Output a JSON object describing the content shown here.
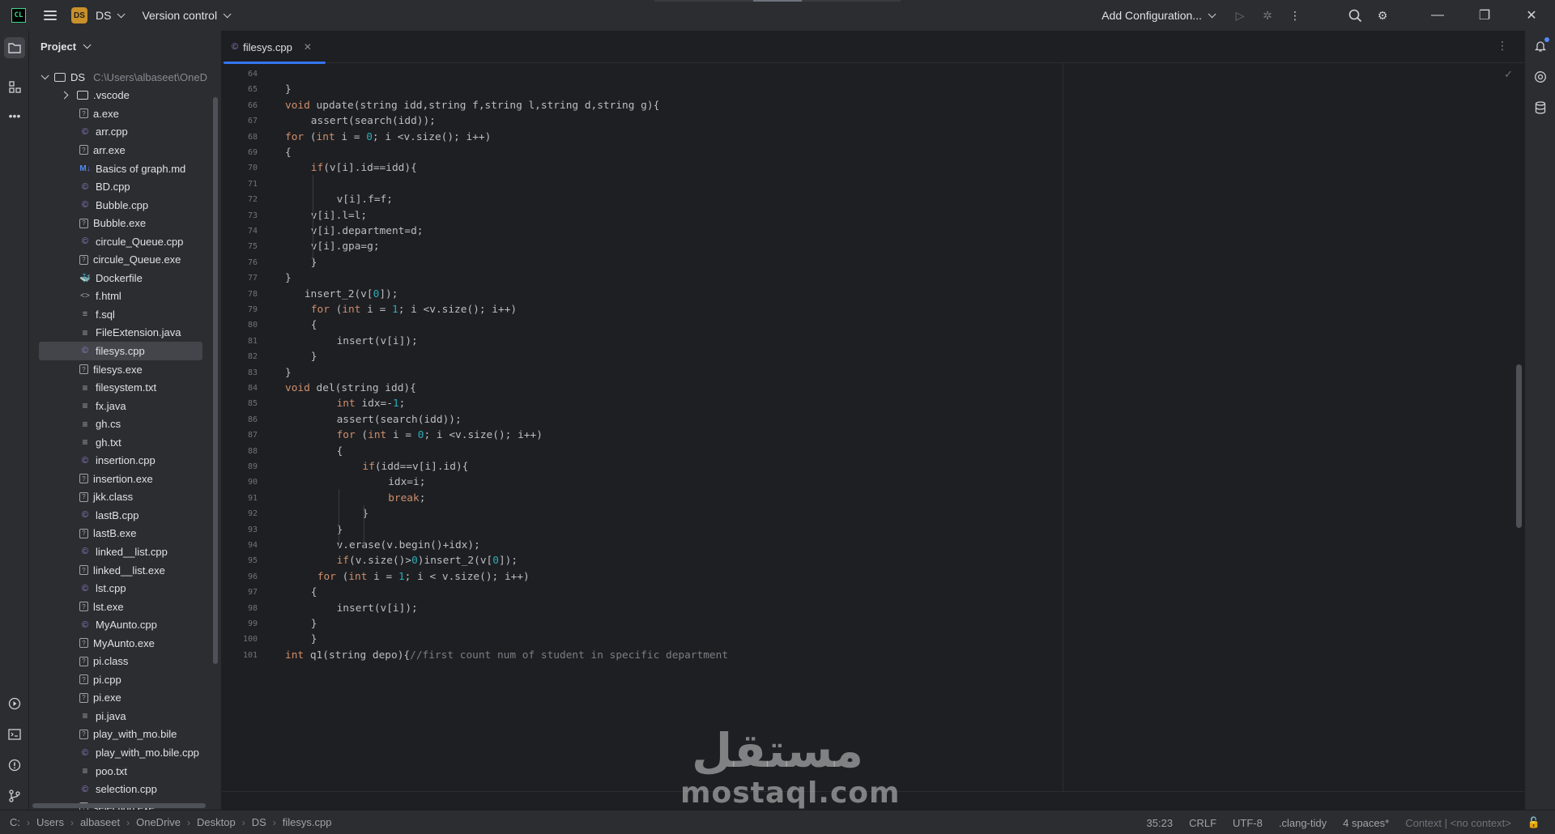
{
  "titlebar": {
    "app_logo": "CL",
    "project_badge": "DS",
    "project_name": "DS",
    "version_control": "Version control",
    "add_configuration": "Add Configuration..."
  },
  "project_panel": {
    "title": "Project",
    "root": {
      "name": "DS",
      "path": "C:\\Users\\albaseet\\OneD"
    },
    "items": [
      {
        "name": ".vscode",
        "icon": "folder"
      },
      {
        "name": "a.exe",
        "icon": "exe"
      },
      {
        "name": "arr.cpp",
        "icon": "cpp"
      },
      {
        "name": "arr.exe",
        "icon": "exe"
      },
      {
        "name": "Basics of graph.md",
        "icon": "md"
      },
      {
        "name": "BD.cpp",
        "icon": "cpp"
      },
      {
        "name": "Bubble.cpp",
        "icon": "cpp"
      },
      {
        "name": "Bubble.exe",
        "icon": "exe"
      },
      {
        "name": "circule_Queue.cpp",
        "icon": "cpp"
      },
      {
        "name": "circule_Queue.exe",
        "icon": "exe"
      },
      {
        "name": "Dockerfile",
        "icon": "docker"
      },
      {
        "name": "f.html",
        "icon": "html"
      },
      {
        "name": "f.sql",
        "icon": "sql"
      },
      {
        "name": "FileExtension.java",
        "icon": "txt"
      },
      {
        "name": "filesys.cpp",
        "icon": "cpp",
        "selected": true
      },
      {
        "name": "filesys.exe",
        "icon": "exe"
      },
      {
        "name": "filesystem.txt",
        "icon": "txt"
      },
      {
        "name": "fx.java",
        "icon": "txt"
      },
      {
        "name": "gh.cs",
        "icon": "txt"
      },
      {
        "name": "gh.txt",
        "icon": "txt"
      },
      {
        "name": "insertion.cpp",
        "icon": "cpp"
      },
      {
        "name": "insertion.exe",
        "icon": "exe"
      },
      {
        "name": "jkk.class",
        "icon": "exe"
      },
      {
        "name": "lastB.cpp",
        "icon": "cpp"
      },
      {
        "name": "lastB.exe",
        "icon": "exe"
      },
      {
        "name": "linked__list.cpp",
        "icon": "cpp"
      },
      {
        "name": "linked__list.exe",
        "icon": "exe"
      },
      {
        "name": "lst.cpp",
        "icon": "cpp"
      },
      {
        "name": "lst.exe",
        "icon": "exe"
      },
      {
        "name": "MyAunto.cpp",
        "icon": "cpp"
      },
      {
        "name": "MyAunto.exe",
        "icon": "exe"
      },
      {
        "name": "pi.class",
        "icon": "exe"
      },
      {
        "name": "pi.cpp",
        "icon": "exe"
      },
      {
        "name": "pi.exe",
        "icon": "exe"
      },
      {
        "name": "pi.java",
        "icon": "txt"
      },
      {
        "name": "play_with_mo.bile",
        "icon": "exe"
      },
      {
        "name": "play_with_mo.bile.cpp",
        "icon": "cpp"
      },
      {
        "name": "poo.txt",
        "icon": "txt"
      },
      {
        "name": "selection.cpp",
        "icon": "cpp"
      },
      {
        "name": "selection.exe",
        "icon": "exe"
      }
    ]
  },
  "editor": {
    "tab_label": "filesys.cpp",
    "lines": [
      {
        "n": "64",
        "indent": 0,
        "tokens": []
      },
      {
        "n": "65",
        "indent": 0,
        "tokens": [
          [
            "t",
            "}"
          ]
        ]
      },
      {
        "n": "66",
        "indent": 0,
        "tokens": [
          [
            "k",
            "void"
          ],
          [
            "t",
            " update(string idd,string f,string l,string d,string g){"
          ]
        ]
      },
      {
        "n": "67",
        "indent": 4,
        "tokens": [
          [
            "t",
            "assert(search(idd));"
          ]
        ]
      },
      {
        "n": "68",
        "indent": 0,
        "tokens": [
          [
            "k",
            "for"
          ],
          [
            "t",
            " ("
          ],
          [
            "k",
            "int"
          ],
          [
            "t",
            " i = "
          ],
          [
            "n",
            "0"
          ],
          [
            "t",
            "; i <v.size(); i++)"
          ]
        ]
      },
      {
        "n": "69",
        "indent": 0,
        "tokens": [
          [
            "t",
            "{"
          ]
        ]
      },
      {
        "n": "70",
        "indent": 4,
        "tokens": [
          [
            "k",
            "if"
          ],
          [
            "t",
            "(v[i].id==idd){"
          ]
        ]
      },
      {
        "n": "71",
        "indent": 0,
        "tokens": []
      },
      {
        "n": "72",
        "indent": 8,
        "tokens": [
          [
            "t",
            "v[i].f=f;"
          ]
        ]
      },
      {
        "n": "73",
        "indent": 4,
        "tokens": [
          [
            "t",
            "v[i].l=l;"
          ]
        ]
      },
      {
        "n": "74",
        "indent": 4,
        "tokens": [
          [
            "t",
            "v[i].department=d;"
          ]
        ]
      },
      {
        "n": "75",
        "indent": 4,
        "tokens": [
          [
            "t",
            "v[i].gpa=g;"
          ]
        ]
      },
      {
        "n": "76",
        "indent": 4,
        "tokens": [
          [
            "t",
            "}"
          ]
        ]
      },
      {
        "n": "77",
        "indent": 0,
        "tokens": [
          [
            "t",
            "}"
          ]
        ]
      },
      {
        "n": "78",
        "indent": 3,
        "tokens": [
          [
            "t",
            "insert_2(v["
          ],
          [
            "n",
            "0"
          ],
          [
            "t",
            "]);"
          ]
        ]
      },
      {
        "n": "79",
        "indent": 4,
        "tokens": [
          [
            "k",
            "for"
          ],
          [
            "t",
            " ("
          ],
          [
            "k",
            "int"
          ],
          [
            "t",
            " i = "
          ],
          [
            "n",
            "1"
          ],
          [
            "t",
            "; i <v.size(); i++)"
          ]
        ]
      },
      {
        "n": "80",
        "indent": 4,
        "tokens": [
          [
            "t",
            "{"
          ]
        ]
      },
      {
        "n": "81",
        "indent": 8,
        "tokens": [
          [
            "t",
            "insert(v[i]);"
          ]
        ]
      },
      {
        "n": "82",
        "indent": 4,
        "tokens": [
          [
            "t",
            "}"
          ]
        ]
      },
      {
        "n": "83",
        "indent": 0,
        "tokens": [
          [
            "t",
            "}"
          ]
        ]
      },
      {
        "n": "84",
        "indent": 0,
        "tokens": [
          [
            "k",
            "void"
          ],
          [
            "t",
            " del(string idd){"
          ]
        ]
      },
      {
        "n": "85",
        "indent": 8,
        "tokens": [
          [
            "k",
            "int"
          ],
          [
            "t",
            " idx=-"
          ],
          [
            "n",
            "1"
          ],
          [
            "t",
            ";"
          ]
        ]
      },
      {
        "n": "86",
        "indent": 8,
        "tokens": [
          [
            "t",
            "assert(search(idd));"
          ]
        ]
      },
      {
        "n": "87",
        "indent": 8,
        "tokens": [
          [
            "k",
            "for"
          ],
          [
            "t",
            " ("
          ],
          [
            "k",
            "int"
          ],
          [
            "t",
            " i = "
          ],
          [
            "n",
            "0"
          ],
          [
            "t",
            "; i <v.size(); i++)"
          ]
        ]
      },
      {
        "n": "88",
        "indent": 8,
        "tokens": [
          [
            "t",
            "{"
          ]
        ]
      },
      {
        "n": "89",
        "indent": 12,
        "tokens": [
          [
            "k",
            "if"
          ],
          [
            "t",
            "(idd==v[i].id){"
          ]
        ]
      },
      {
        "n": "90",
        "indent": 16,
        "tokens": [
          [
            "t",
            "idx=i;"
          ]
        ]
      },
      {
        "n": "91",
        "indent": 16,
        "tokens": [
          [
            "k",
            "break"
          ],
          [
            "t",
            ";"
          ]
        ]
      },
      {
        "n": "92",
        "indent": 12,
        "tokens": [
          [
            "t",
            "}"
          ]
        ]
      },
      {
        "n": "93",
        "indent": 8,
        "tokens": [
          [
            "t",
            "}"
          ]
        ]
      },
      {
        "n": "94",
        "indent": 8,
        "tokens": [
          [
            "t",
            "v.erase(v.begin()+idx);"
          ]
        ]
      },
      {
        "n": "95",
        "indent": 8,
        "tokens": [
          [
            "k",
            "if"
          ],
          [
            "t",
            "(v.size()>"
          ],
          [
            "n",
            "0"
          ],
          [
            "t",
            ")insert_2(v["
          ],
          [
            "n",
            "0"
          ],
          [
            "t",
            "]);"
          ]
        ]
      },
      {
        "n": "96",
        "indent": 5,
        "tokens": [
          [
            "k",
            "for"
          ],
          [
            "t",
            " ("
          ],
          [
            "k",
            "int"
          ],
          [
            "t",
            " i = "
          ],
          [
            "n",
            "1"
          ],
          [
            "t",
            "; i < v.size(); i++)"
          ]
        ]
      },
      {
        "n": "97",
        "indent": 4,
        "tokens": [
          [
            "t",
            "{"
          ]
        ]
      },
      {
        "n": "98",
        "indent": 8,
        "tokens": [
          [
            "t",
            "insert(v[i]);"
          ]
        ]
      },
      {
        "n": "99",
        "indent": 4,
        "tokens": [
          [
            "t",
            "}"
          ]
        ]
      },
      {
        "n": "100",
        "indent": 4,
        "tokens": [
          [
            "t",
            "}"
          ]
        ]
      },
      {
        "n": "101",
        "indent": 0,
        "tokens": [
          [
            "k",
            "int"
          ],
          [
            "t",
            " q1(string depo){"
          ],
          [
            "c",
            "//first count num of student in specific department"
          ]
        ]
      }
    ]
  },
  "statusbar": {
    "breadcrumbs": [
      "C:",
      "Users",
      "albaseet",
      "OneDrive",
      "Desktop",
      "DS",
      "filesys.cpp"
    ],
    "position": "35:23",
    "line_ending": "CRLF",
    "encoding": "UTF-8",
    "linter": ".clang-tidy",
    "indent": "4 spaces*",
    "context_label": "Context",
    "context_value": "<no context>"
  },
  "watermark": {
    "arabic": "مستقل",
    "latin": "mostaql.com"
  },
  "colors": {
    "keyword": "#cf8e6d",
    "number": "#2aacb8",
    "comment": "#7a7e85",
    "accent": "#3574f0",
    "project_badge": "#c9912a"
  }
}
